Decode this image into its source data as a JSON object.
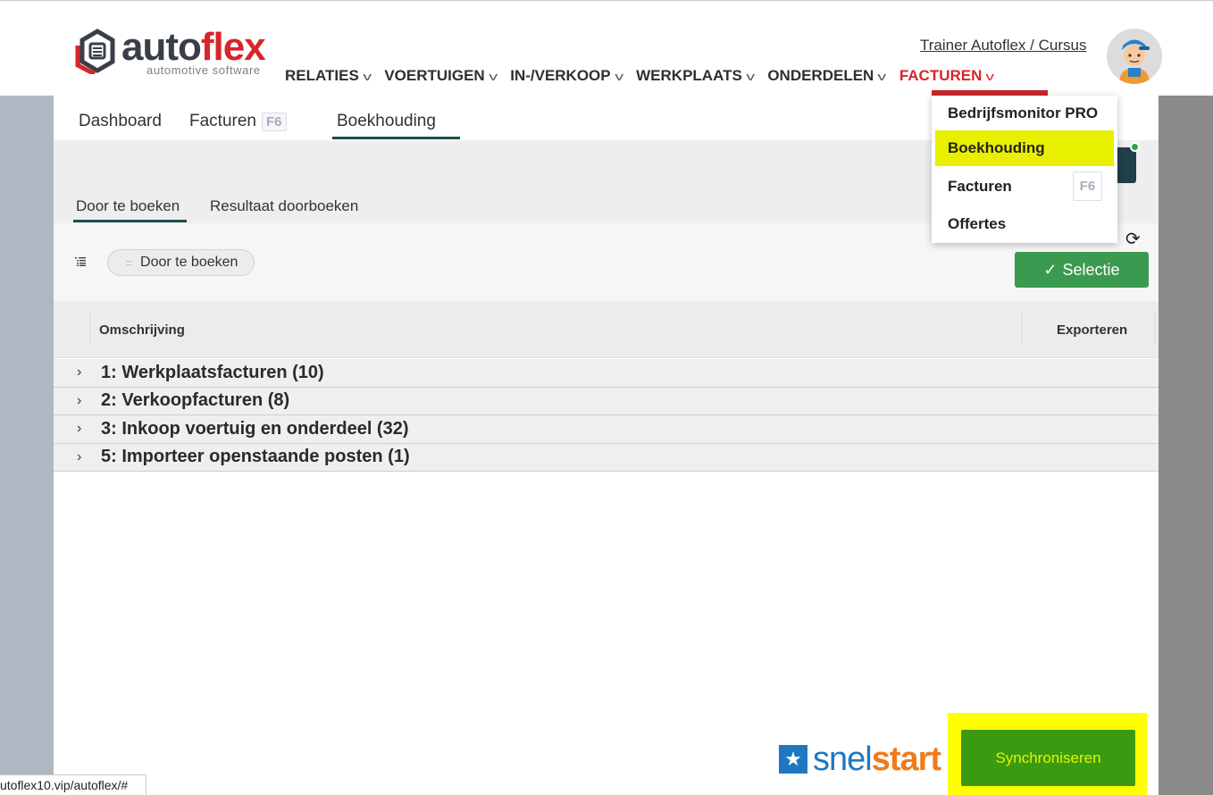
{
  "header": {
    "logo_main": "auto",
    "logo_accent": "flex",
    "logo_sub": "automotive software",
    "user": "Trainer Autoflex / Cursus",
    "nav": [
      {
        "label": "RELATIES"
      },
      {
        "label": "VOERTUIGEN"
      },
      {
        "label": "IN-/VERKOOP"
      },
      {
        "label": "WERKPLAATS"
      },
      {
        "label": "ONDERDELEN"
      },
      {
        "label": "FACTUREN"
      }
    ],
    "active_color": "#d6262b"
  },
  "subtabs": {
    "dashboard": "Dashboard",
    "facturen": "Facturen",
    "facturen_key": "F6",
    "boekhouding": "Boekhouding"
  },
  "inner_tabs": {
    "door": "Door te boeken",
    "resultaat": "Resultaat doorboeken"
  },
  "toolbar": {
    "chip": "Door te boeken",
    "selectie": "Selectie"
  },
  "table": {
    "col_omschrijving": "Omschrijving",
    "col_exporteren": "Exporteren",
    "rows": [
      {
        "label": "1: Werkplaatsfacturen (10)"
      },
      {
        "label": "2: Verkoopfacturen (8)"
      },
      {
        "label": "3: Inkoop voertuig en onderdeel (32)"
      },
      {
        "label": "5: Importeer openstaande posten (1)"
      }
    ]
  },
  "footer": {
    "snel": "snel",
    "start": "start",
    "sync": "Synchroniseren"
  },
  "dropdown": {
    "items": [
      {
        "label": "Bedrijfsmonitor PRO"
      },
      {
        "label": "Boekhouding"
      },
      {
        "label": "Facturen",
        "key": "F6"
      },
      {
        "label": "Offertes"
      }
    ]
  },
  "statusbar": "utoflex10.vip/autoflex/#"
}
